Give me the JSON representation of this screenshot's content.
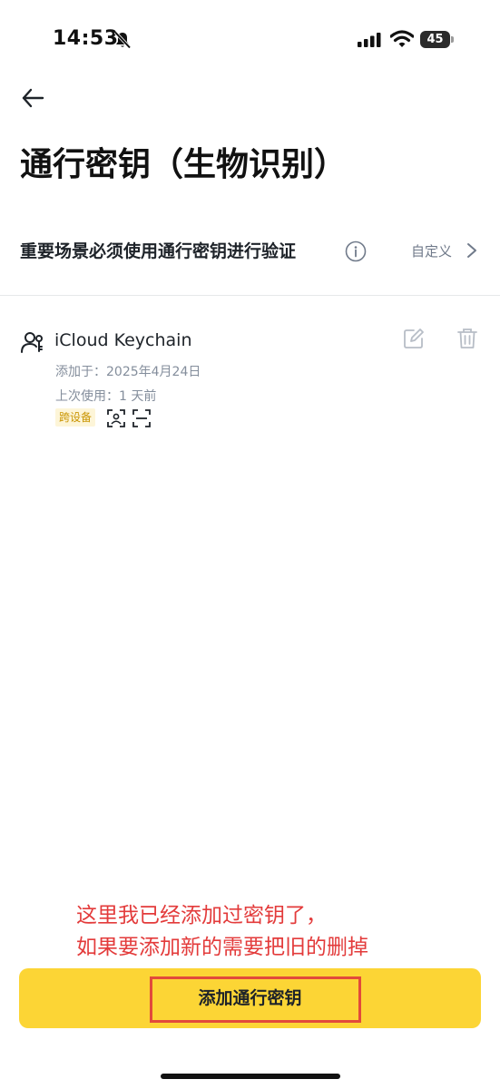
{
  "status_bar": {
    "time": "14:53",
    "battery": "45"
  },
  "header": {
    "back_icon": "arrow-left-icon",
    "title": "通行密钥（生物识别）"
  },
  "setting": {
    "label": "重要场景必须使用通行密钥进行验证",
    "value": "自定义"
  },
  "passkey": {
    "name": "iCloud Keychain",
    "added": "添加于：2025年4月24日",
    "last_used": "上次使用：1 天前",
    "tag": "跨设备"
  },
  "annotation": {
    "line1": "这里我已经添加过密钥了，",
    "line2": "如果要添加新的需要把旧的删掉",
    "color": "#e33b3b"
  },
  "cta": {
    "label": "添加通行密钥",
    "color": "#fcd535"
  }
}
